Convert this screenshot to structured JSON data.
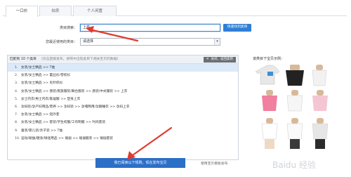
{
  "tabs": [
    {
      "label": "一口价",
      "active": true
    },
    {
      "label": "拍卖",
      "active": false
    },
    {
      "label": "个人闲置",
      "active": false
    }
  ],
  "form": {
    "search_label": "类目搜索：",
    "search_value": "上衣",
    "search_button": "快速找到类目",
    "recent_label": "您最近使用的类目：",
    "recent_value": "请选择"
  },
  "results": {
    "count_label": "匹配到 10 个类目",
    "hint": "(双击直接发布，按萄中出现类目下相关宝贝的数据)",
    "close_label": "关闭，返回类目",
    "items": [
      {
        "num": "1.",
        "text": "女装/女士精品 >> T恤"
      },
      {
        "num": "2.",
        "text": "女装/女士精品 >> 蕾丝衫/雪纺衫"
      },
      {
        "num": "3.",
        "text": "女装/女士精品 >> 毛针织衫"
      },
      {
        "num": "4.",
        "text": "女装/女士精品 >> 唐装/民族服装/舞台服装 >> 唐装/中式服装 >> 上衣"
      },
      {
        "num": "5.",
        "text": "女士内衣/男士内衣/家居服 >> 塑身上衣"
      },
      {
        "num": "6.",
        "text": "孕妇装/孕产妇用品/营养 >> 孕妇装 >> 孕哺两用/孕期睡衣 >> 孕妇上衣"
      },
      {
        "num": "7.",
        "text": "女装/女士精品 >> 短外套"
      },
      {
        "num": "8.",
        "text": "女装/女士精品 >> 套装/学生校服/工作制服 >> 时尚套装"
      },
      {
        "num": "9.",
        "text": "童装/婴儿装/亲子装 >> T恤"
      },
      {
        "num": "10.",
        "text": "运动/瑜伽/健身/球迷用品 >> 瑜伽 >> 瑜伽服装 >> 瑜伽套装"
      }
    ]
  },
  "preview": {
    "title": "该类目下宝贝示例："
  },
  "footer": {
    "publish_button": "我已阅读以下规则，现在发布宝贝",
    "old_link": "使用宝贝模板发布",
    "watermark": "Baidu 经验"
  },
  "colors": {
    "arrow": "#e23a2e",
    "accent": "#2f7fd6",
    "selected_row": "#dbe9f8"
  },
  "icons": {
    "close": "close-icon",
    "dropdown": "chevron-down-icon"
  }
}
